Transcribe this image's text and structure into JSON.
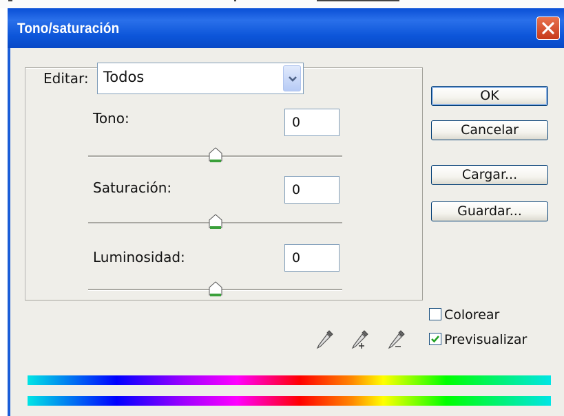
{
  "dialog": {
    "title": "Tono/saturación"
  },
  "editar": {
    "label": "Editar:",
    "selected": "Todos"
  },
  "tono": {
    "label": "Tono:",
    "value": "0",
    "slider_level": 0.5
  },
  "saturacion": {
    "label": "Saturación:",
    "value": "0",
    "slider_level": 0.5
  },
  "luminosidad": {
    "label": "Luminosidad:",
    "value": "0",
    "slider_level": 0.5
  },
  "buttons": {
    "ok": "OK",
    "cancel": "Cancelar",
    "load": "Cargar...",
    "save": "Guardar..."
  },
  "options": {
    "colorize_label": "Colorear",
    "colorize_checked": false,
    "preview_label": "Previsualizar",
    "preview_checked": true
  },
  "icons": [
    "close-icon",
    "chevron-down-icon",
    "eyedropper-icon",
    "eyedropper-plus-icon",
    "eyedropper-minus-icon",
    "checkmark-icon"
  ],
  "colors": {
    "titlebar": "#0c55d9",
    "dialog_bg": "#efeee9",
    "close_button": "#d5502b",
    "slider_thumb_accent": "#3aa03a"
  }
}
